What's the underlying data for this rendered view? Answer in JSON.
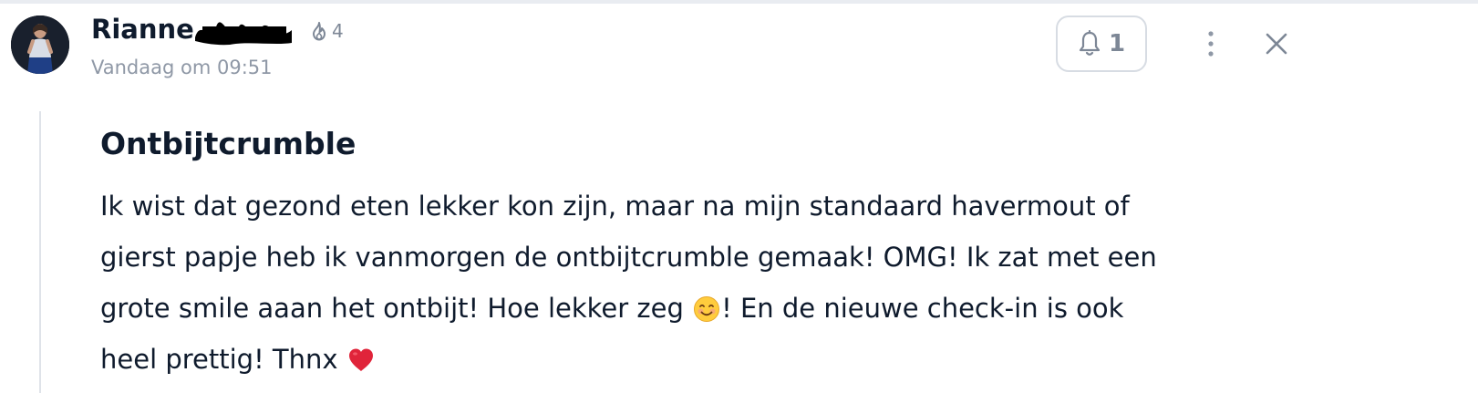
{
  "author": {
    "name": "Rianne",
    "streak_count": "4",
    "timestamp": "Vandaag om 09:51"
  },
  "actions": {
    "notification_count": "1"
  },
  "post": {
    "title": "Ontbijtcrumble",
    "lines": [
      "Ik wist dat gezond eten lekker kon zijn, maar na mijn standaard havermout of",
      "gierst papje heb ik vanmorgen de ontbijtcrumble gemaak! OMG! Ik zat met een",
      "grote smile aaan het ontbijt! Hoe lekker zeg",
      "! En de nieuwe check-in is ook",
      "heel prettig! Thnx"
    ]
  },
  "icons": {
    "streak": "flame-icon",
    "notification": "bell-icon",
    "more": "more-vertical-icon",
    "close": "close-icon",
    "smile_emoji": "smiling-face-emoji",
    "heart_emoji": "red-heart-emoji"
  },
  "colors": {
    "text_primary": "#0f1b2d",
    "text_muted": "#8f98a6",
    "icon_gray": "#7d8796",
    "border": "#d7dce3",
    "thread_line": "#dfe3e9",
    "heart": "#e0243a",
    "redaction": "#000000"
  }
}
